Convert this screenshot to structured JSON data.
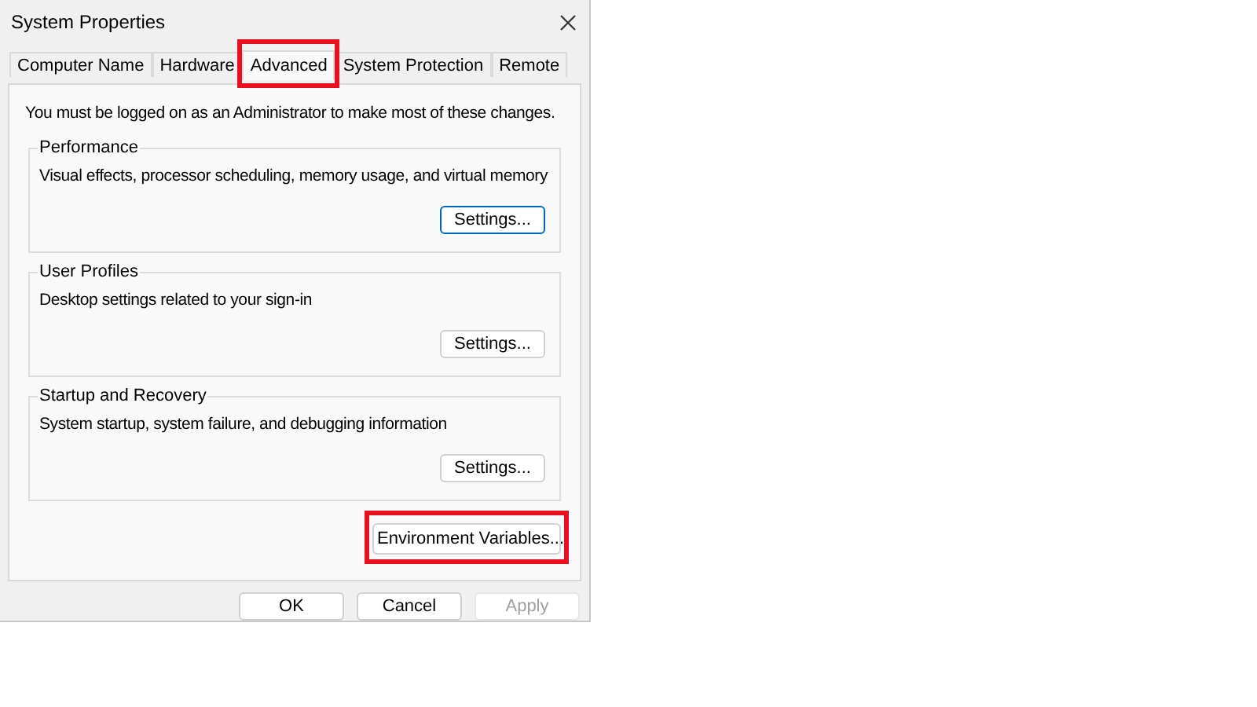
{
  "window": {
    "title": "System Properties"
  },
  "tabs": [
    {
      "label": "Computer Name",
      "selected": false,
      "highlighted": false
    },
    {
      "label": "Hardware",
      "selected": false,
      "highlighted": false
    },
    {
      "label": "Advanced",
      "selected": true,
      "highlighted": true
    },
    {
      "label": "System Protection",
      "selected": false,
      "highlighted": false
    },
    {
      "label": "Remote",
      "selected": false,
      "highlighted": false
    }
  ],
  "notice": "You must be logged on as an Administrator to make most of these changes.",
  "groups": [
    {
      "title": "Performance",
      "description": "Visual effects, processor scheduling, memory usage, and virtual memory",
      "button": {
        "label": "Settings...",
        "focused": true
      }
    },
    {
      "title": "User Profiles",
      "description": "Desktop settings related to your sign-in",
      "button": {
        "label": "Settings...",
        "focused": false
      }
    },
    {
      "title": "Startup and Recovery",
      "description": "System startup, system failure, and debugging information",
      "button": {
        "label": "Settings...",
        "focused": false
      }
    }
  ],
  "environment_button": {
    "label": "Environment Variables...",
    "highlighted": true
  },
  "buttons": [
    {
      "label": "OK",
      "disabled": false
    },
    {
      "label": "Cancel",
      "disabled": false
    },
    {
      "label": "Apply",
      "disabled": true
    }
  ]
}
